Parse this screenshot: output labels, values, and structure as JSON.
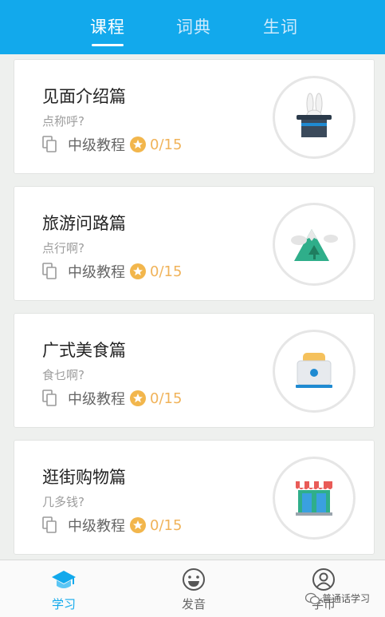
{
  "tabs": [
    {
      "label": "课程",
      "active": true
    },
    {
      "label": "词典",
      "active": false
    },
    {
      "label": "生词",
      "active": false
    }
  ],
  "lessons": [
    {
      "title": "见面介绍篇",
      "subtitle": "点称呼?",
      "level": "中级教程",
      "progress": "0/15",
      "icon": "magic-hat-icon"
    },
    {
      "title": "旅游问路篇",
      "subtitle": "点行啊?",
      "level": "中级教程",
      "progress": "0/15",
      "icon": "mountain-icon"
    },
    {
      "title": "广式美食篇",
      "subtitle": "食乜啊?",
      "level": "中级教程",
      "progress": "0/15",
      "icon": "toaster-icon"
    },
    {
      "title": "逛街购物篇",
      "subtitle": "几多钱?",
      "level": "中级教程",
      "progress": "0/15",
      "icon": "shop-icon"
    }
  ],
  "bottom_nav": [
    {
      "label": "学习",
      "icon": "graduation-cap-icon",
      "active": true
    },
    {
      "label": "发音",
      "icon": "smiley-icon",
      "active": false
    },
    {
      "label": "学币",
      "icon": "user-icon",
      "active": false
    }
  ],
  "watermark": {
    "text": "普通话学习"
  },
  "colors": {
    "accent": "#12a9ec",
    "progress": "#f0b35a",
    "star": "#f2b64c"
  }
}
